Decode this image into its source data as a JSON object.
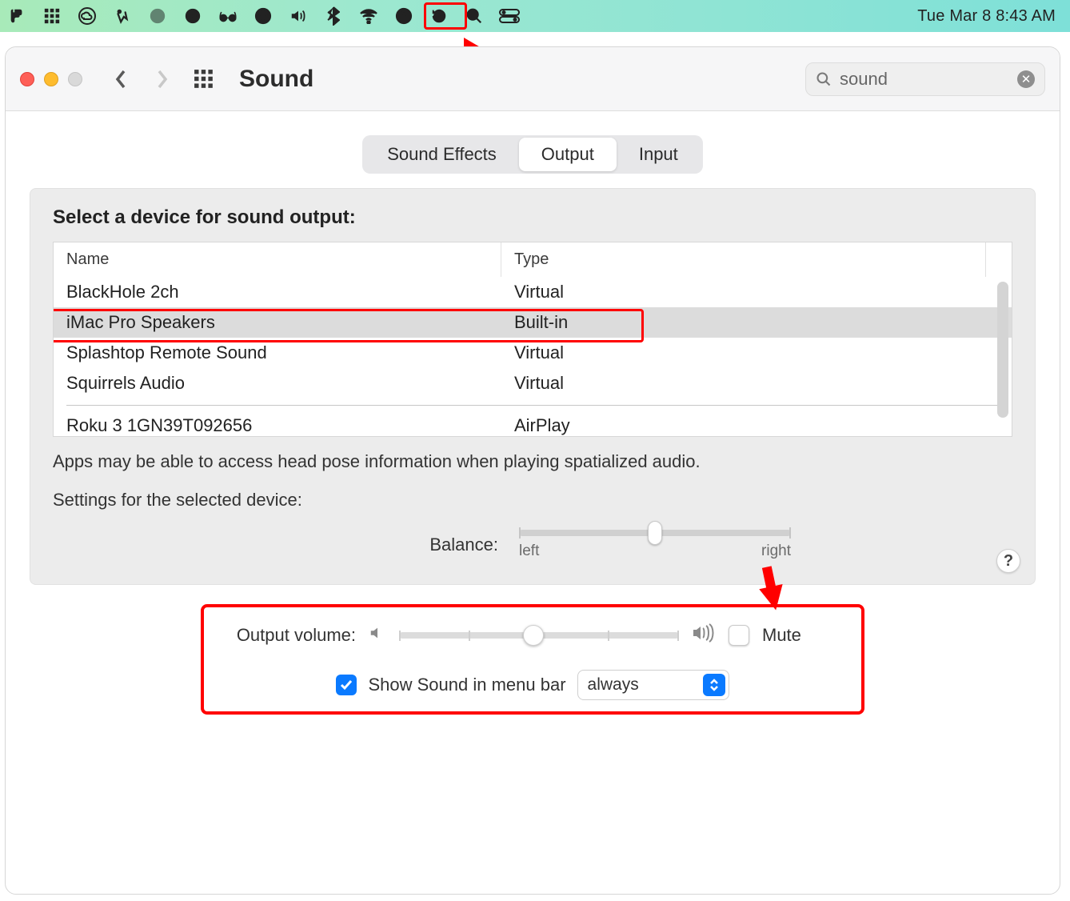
{
  "menubar": {
    "datetime": "Tue Mar 8  8:43 AM"
  },
  "window": {
    "title": "Sound",
    "search_value": "sound"
  },
  "tabs": {
    "effects": "Sound Effects",
    "output": "Output",
    "input": "Input"
  },
  "output": {
    "select_label": "Select a device for sound output:",
    "col_name": "Name",
    "col_type": "Type",
    "devices": [
      {
        "name": "BlackHole 2ch",
        "type": "Virtual"
      },
      {
        "name": "iMac Pro Speakers",
        "type": "Built-in"
      },
      {
        "name": "Splashtop Remote Sound",
        "type": "Virtual"
      },
      {
        "name": "Squirrels Audio",
        "type": "Virtual"
      },
      {
        "name": "Roku 3   1GN39T092656",
        "type": "AirPlay"
      }
    ],
    "note": "Apps may be able to access head pose information when playing spatialized audio.",
    "settings_label": "Settings for the selected device:",
    "balance_label": "Balance:",
    "balance_left": "left",
    "balance_right": "right",
    "help": "?"
  },
  "volume": {
    "label": "Output volume:",
    "mute_label": "Mute",
    "show_label": "Show Sound in menu bar",
    "show_select": "always"
  }
}
